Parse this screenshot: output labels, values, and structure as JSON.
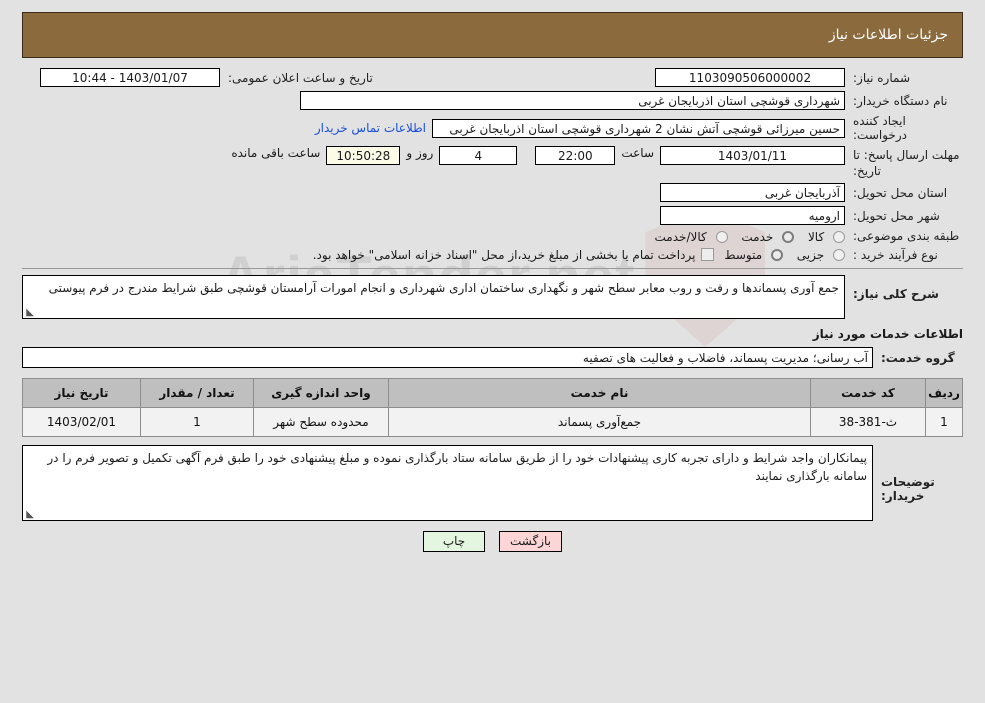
{
  "header": {
    "title": "جزئیات اطلاعات نیاز"
  },
  "fields": {
    "need_number_label": "شماره نیاز:",
    "need_number_value": "1103090506000002",
    "announce_label": "تاریخ و ساعت اعلان عمومی:",
    "announce_value": "1403/01/07 - 10:44",
    "buyer_org_label": "نام دستگاه خریدار:",
    "buyer_org_value": "شهرداری قوشچی استان اذربایجان غربی",
    "requester_label": "ایجاد کننده درخواست:",
    "requester_value": "حسین میرزائی قوشچی آتش نشان 2 شهرداری قوشچی استان اذربایجان غربی",
    "contact_link": "اطلاعات تماس خریدار",
    "deadline_label": "مهلت ارسال پاسخ: تا تاریخ:",
    "deadline_date": "1403/01/11",
    "deadline_hour_label": "ساعت",
    "deadline_hour": "22:00",
    "remaining_days": "4",
    "remaining_days_label": "روز و",
    "remaining_time": "10:50:28",
    "remaining_time_label": "ساعت باقی مانده",
    "province_label": "استان محل تحویل:",
    "province_value": "آذربایجان غربی",
    "city_label": "شهر محل تحویل:",
    "city_value": "ارومیه",
    "category_label": "طبقه بندی موضوعی:",
    "process_label": "نوع فرآیند خرید :",
    "treasury_checkbox_label": "پرداخت تمام یا بخشی از مبلغ خرید،از محل \"اسناد خزانه اسلامی\" خواهد بود."
  },
  "category_options": [
    {
      "label": "کالا",
      "selected": false
    },
    {
      "label": "خدمت",
      "selected": true
    },
    {
      "label": "کالا/خدمت",
      "selected": false
    }
  ],
  "process_options": [
    {
      "label": "جزیی",
      "selected": false
    },
    {
      "label": "متوسط",
      "selected": true
    }
  ],
  "description": {
    "label": "شرح کلی نیاز:",
    "value": "جمع آوری پسماندها و رفت و روب معابر سطح شهر و نگهداری ساختمان اداری شهرداری و انجام امورات آرامستان قوشچی طبق شرایط مندرج در فرم پیوستی"
  },
  "services_section": {
    "title": "اطلاعات خدمات مورد نیاز",
    "group_label": "گروه خدمت:",
    "group_value": "آب رسانی؛ مدیریت پسماند، فاضلاب و فعالیت های تصفیه"
  },
  "table": {
    "columns": [
      "ردیف",
      "کد خدمت",
      "نام خدمت",
      "واحد اندازه گیری",
      "تعداد / مقدار",
      "تاریخ نیاز"
    ],
    "rows": [
      {
        "radif": "1",
        "code": "ث-381-38",
        "name": "جمع‌آوری پسماند",
        "unit": "محدوده سطح شهر",
        "qty": "1",
        "date": "1403/02/01"
      }
    ]
  },
  "buyer_notes": {
    "label": "توضیحات خریدار:",
    "value": "پیمانکاران واجد شرایط و دارای تجربه کاری پیشنهادات خود را از طریق سامانه ستاد بارگذاری نموده و مبلغ پیشنهادی خود را طبق فرم آگهی تکمیل و تصویر فرم را در سامانه بارگذاری نمایند"
  },
  "footer": {
    "back_label": "بازگشت",
    "print_label": "چاپ"
  },
  "watermark": {
    "text": "AriaTender.net"
  },
  "colors": {
    "header_bg": "#8b6b3e",
    "page_bg": "#e2e2e2",
    "link": "#1b4fd8",
    "table_header_bg": "#bfbfbf",
    "table_row_bg": "#f2f2f2",
    "back_button_bg": "#fcd6d6",
    "print_button_bg": "#e4f5e0",
    "countdown_bg": "#fbfbe8"
  }
}
